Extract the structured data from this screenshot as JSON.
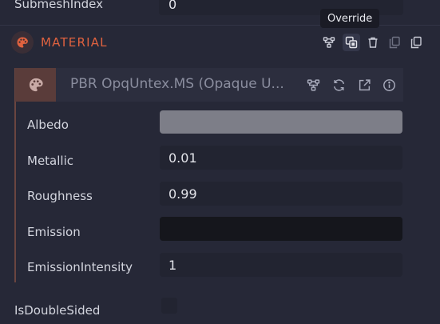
{
  "submesh": {
    "label": "SubmeshIndex",
    "value": "0"
  },
  "material": {
    "title": "MATERIAL",
    "tooltip": "Override",
    "header_icons": [
      "graph-icon",
      "override-icon",
      "trash-icon",
      "copy-icon",
      "duplicate-icon"
    ]
  },
  "asset": {
    "name": "PBR OpqUntex.MS (Opaque U...",
    "icons": [
      "graph-icon",
      "refresh-icon",
      "open-external-icon",
      "info-icon"
    ]
  },
  "properties": {
    "albedo": {
      "label": "Albedo",
      "color": "#7d7e88"
    },
    "metallic": {
      "label": "Metallic",
      "value": "0.01"
    },
    "roughness": {
      "label": "Roughness",
      "value": "0.99"
    },
    "emission": {
      "label": "Emission",
      "color": "#15161c"
    },
    "emission_intensity": {
      "label": "EmissionIntensity",
      "value": "1"
    }
  },
  "double_sided": {
    "label": "IsDoubleSided",
    "checked": false
  },
  "colors": {
    "background": "#262837",
    "accent": "#e0623f",
    "field": "#222431"
  }
}
